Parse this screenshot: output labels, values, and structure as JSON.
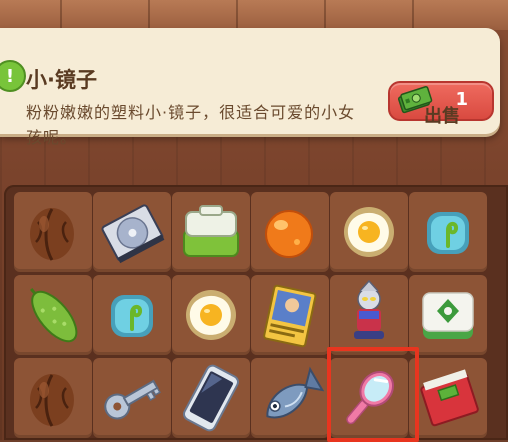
{
  "item": {
    "name": "小·镜子",
    "description": "粉粉嫩嫩的塑料小·镜子，很适合可爱的小女孩呢。",
    "alert_icon": "!"
  },
  "sell": {
    "price": "1",
    "label": "出售",
    "currency_icon": "cash-icon"
  },
  "inventory": {
    "rows": [
      [
        "walnut",
        "cd-case",
        "lunch-box",
        "orange-ball",
        "fried-egg",
        "fern-bubble"
      ],
      [
        "bitter-melon",
        "fern-bubble",
        "fried-egg",
        "trading-card",
        "hero-figure",
        "mahjong-tile"
      ],
      [
        "walnut",
        "key",
        "smartphone",
        "fish",
        "hand-mirror",
        "red-book"
      ]
    ],
    "selected": "hand-mirror"
  },
  "colors": {
    "panel": "#f6ecd6",
    "accent_red": "#e8351f",
    "price_red": "#d94a40",
    "alert_green": "#78c43a"
  }
}
